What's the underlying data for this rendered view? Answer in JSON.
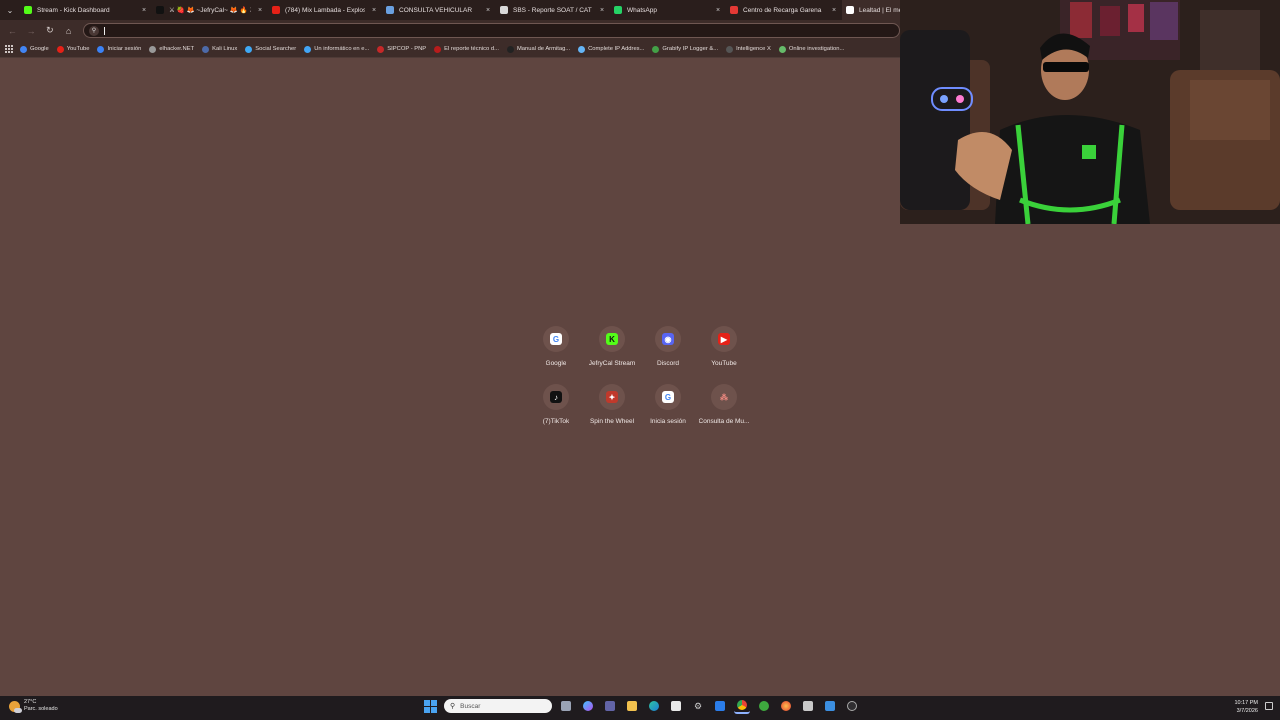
{
  "browser": {
    "tabs": [
      {
        "title": "Stream - Kick Dashboard",
        "icon": "kick-icon",
        "color": "#53fc18",
        "active": false
      },
      {
        "title": "⚔ 🍓 🦊 ~JefryCal~ 🦊 🔥 ⚔",
        "icon": "tiktok-icon",
        "color": "#111111",
        "active": false
      },
      {
        "title": "(784) Mix Lambada - Explosió",
        "icon": "youtube-icon",
        "color": "#e62117",
        "active": false
      },
      {
        "title": "CONSULTA VEHICULAR",
        "icon": "sunarp-icon",
        "color": "#6aa0e0",
        "active": false
      },
      {
        "title": "SBS - Reporte SOAT / CAT y S",
        "icon": "sbs-icon",
        "color": "#d9d9d9",
        "active": false
      },
      {
        "title": "WhatsApp",
        "icon": "whatsapp-icon",
        "color": "#25d366",
        "active": false
      },
      {
        "title": "Centro de Recarga Garena",
        "icon": "garena-icon",
        "color": "#e53935",
        "active": false
      },
      {
        "title": "Lealtad | El mejor softw",
        "icon": "lealtad-icon",
        "color": "#ffffff",
        "active": true
      }
    ],
    "omnibox_value": "",
    "bookmarks": [
      {
        "label": "Google",
        "color": "#4285f4"
      },
      {
        "label": "YouTube",
        "color": "#e62117"
      },
      {
        "label": "Iniciar sesión",
        "color": "#3b82f6"
      },
      {
        "label": "elhacker.NET",
        "color": "#999999"
      },
      {
        "label": "Kali Linux",
        "color": "#4d6aa8"
      },
      {
        "label": "Social Searcher",
        "color": "#3fa9f5"
      },
      {
        "label": "Un informático en e...",
        "color": "#42a5f5"
      },
      {
        "label": "SIPCOP - PNP",
        "color": "#c62828"
      },
      {
        "label": "El reporte técnico d...",
        "color": "#b71c1c"
      },
      {
        "label": "Manual de Armitag...",
        "color": "#222222"
      },
      {
        "label": "Complete IP Addres...",
        "color": "#64b5f6"
      },
      {
        "label": "Grabify IP Logger &...",
        "color": "#43a047"
      },
      {
        "label": "Intelligence X",
        "color": "#555555"
      },
      {
        "label": "Online investigation...",
        "color": "#66bb6a"
      }
    ]
  },
  "shortcuts": [
    {
      "label": "Google",
      "glyph": "G",
      "fg": "#4285f4",
      "bg": "#ffffff"
    },
    {
      "label": "JefryCal Stream",
      "glyph": "K",
      "fg": "#111111",
      "bg": "#53fc18"
    },
    {
      "label": "Discord",
      "glyph": "◉",
      "fg": "#ffffff",
      "bg": "#5865f2"
    },
    {
      "label": "YouTube",
      "glyph": "▶",
      "fg": "#ffffff",
      "bg": "#e62117"
    },
    {
      "label": "(7)TikTok",
      "glyph": "♪",
      "fg": "#ffffff",
      "bg": "#111111"
    },
    {
      "label": "Spin the Wheel",
      "glyph": "✦",
      "fg": "#ffffff",
      "bg": "#c0392b"
    },
    {
      "label": "Inicia sesión",
      "glyph": "G",
      "fg": "#4285f4",
      "bg": "#ffffff"
    },
    {
      "label": "Consulta de Mu...",
      "glyph": "⁂",
      "fg": "#f28b82",
      "bg": "transparent"
    }
  ],
  "taskbar": {
    "weather_temp": "27°C",
    "weather_desc": "Parc. soleado",
    "search_placeholder": "Buscar",
    "time": "10:17 PM",
    "date": "3/7/2026"
  }
}
